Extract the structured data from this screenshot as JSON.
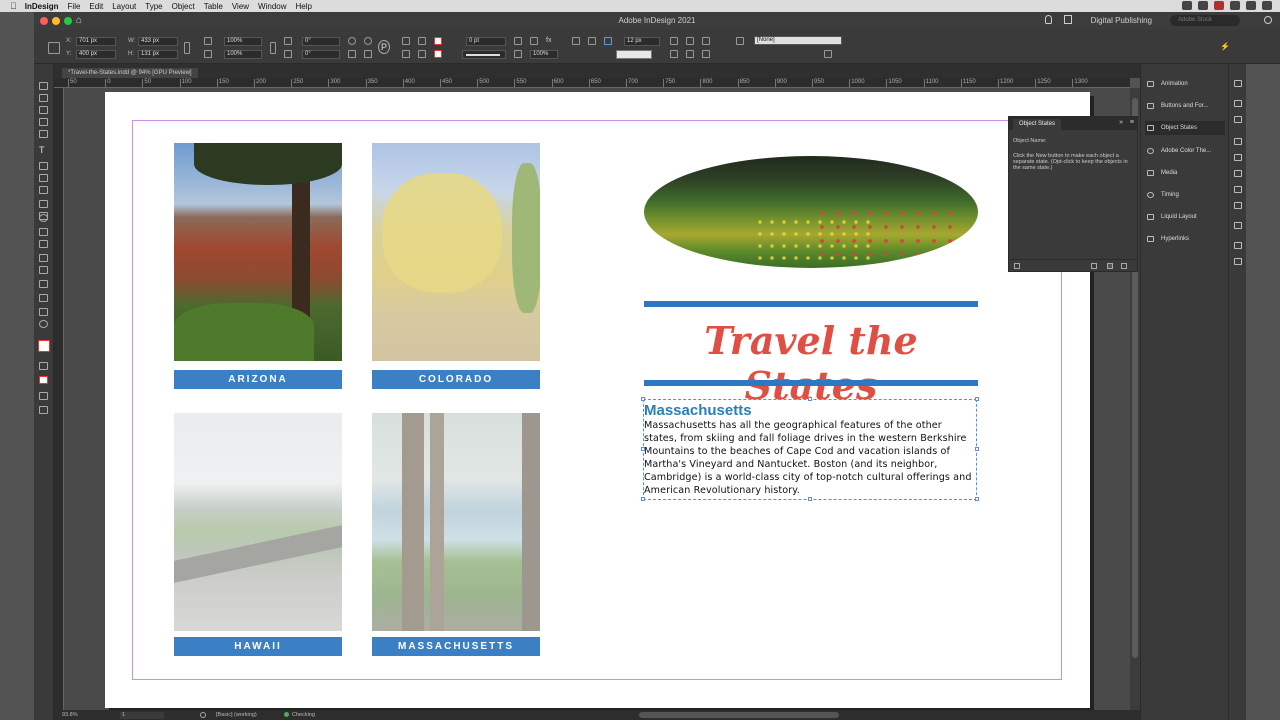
{
  "menubar": {
    "app": "InDesign",
    "items": [
      "File",
      "Edit",
      "Layout",
      "Type",
      "Object",
      "Table",
      "View",
      "Window",
      "Help"
    ]
  },
  "window": {
    "title": "Adobe InDesign 2021",
    "workspace": "Digital Publishing",
    "stock_placeholder": "Adobe Stock"
  },
  "control": {
    "x": "701 px",
    "y": "400 px",
    "w": "433 px",
    "h": "131 px",
    "scale_x": "100%",
    "scale_y": "100%",
    "angle": "0°",
    "shear": "0°",
    "stroke_weight": "0 pt",
    "opacity": "100%",
    "gap": "12 px",
    "style": "[None]",
    "labels": {
      "x": "X:",
      "y": "Y:",
      "w": "W:",
      "h": "H:"
    }
  },
  "document": {
    "tab": "*Travel-the-States.indd @ 94% [GPU Preview]"
  },
  "ruler": {
    "ticks": [
      "50",
      "0",
      "50",
      "100",
      "150",
      "200",
      "250",
      "300",
      "350",
      "400",
      "450",
      "500",
      "550",
      "600",
      "650",
      "700",
      "750",
      "800",
      "850",
      "900",
      "950",
      "1000",
      "1050",
      "1100",
      "1150",
      "1200",
      "1250",
      "1300"
    ]
  },
  "page": {
    "states": [
      "ARIZONA",
      "COLORADO",
      "HAWAII",
      "MASSACHUSETTS"
    ],
    "headline": "Travel the States",
    "article_title": "Massachusetts",
    "article_body": "Massachusetts has all the geographical features of the other states, from skiing and fall foliage drives in the western Berkshire Mountains to the beaches of Cape Cod and vacation islands of Martha's Vineyard and Nantucket. Boston (and its neighbor, Cambridge) is a world-class city of top-notch cultural offerings and American Revolutionary history."
  },
  "object_states_panel": {
    "title": "Object States",
    "object_name_label": "Object Name:",
    "description": "Click the New button to make each object a separate state. (Opt-click to keep the objects in the same state.)"
  },
  "right_panel": {
    "items": [
      "Animation",
      "Buttons and For...",
      "Object States",
      "Adobe Color The...",
      "Media",
      "Timing",
      "Liquid Layout",
      "Hyperlinks"
    ]
  },
  "status": {
    "zoom": "93.8%",
    "page": "1",
    "style": "[Basic] (working)",
    "preflight": "Checking"
  },
  "colors": {
    "label_blue": "#3b7fc4",
    "headline_red": "#e04f43",
    "article_title_blue": "#2a7fb8",
    "rule_blue": "#2e78c2"
  }
}
